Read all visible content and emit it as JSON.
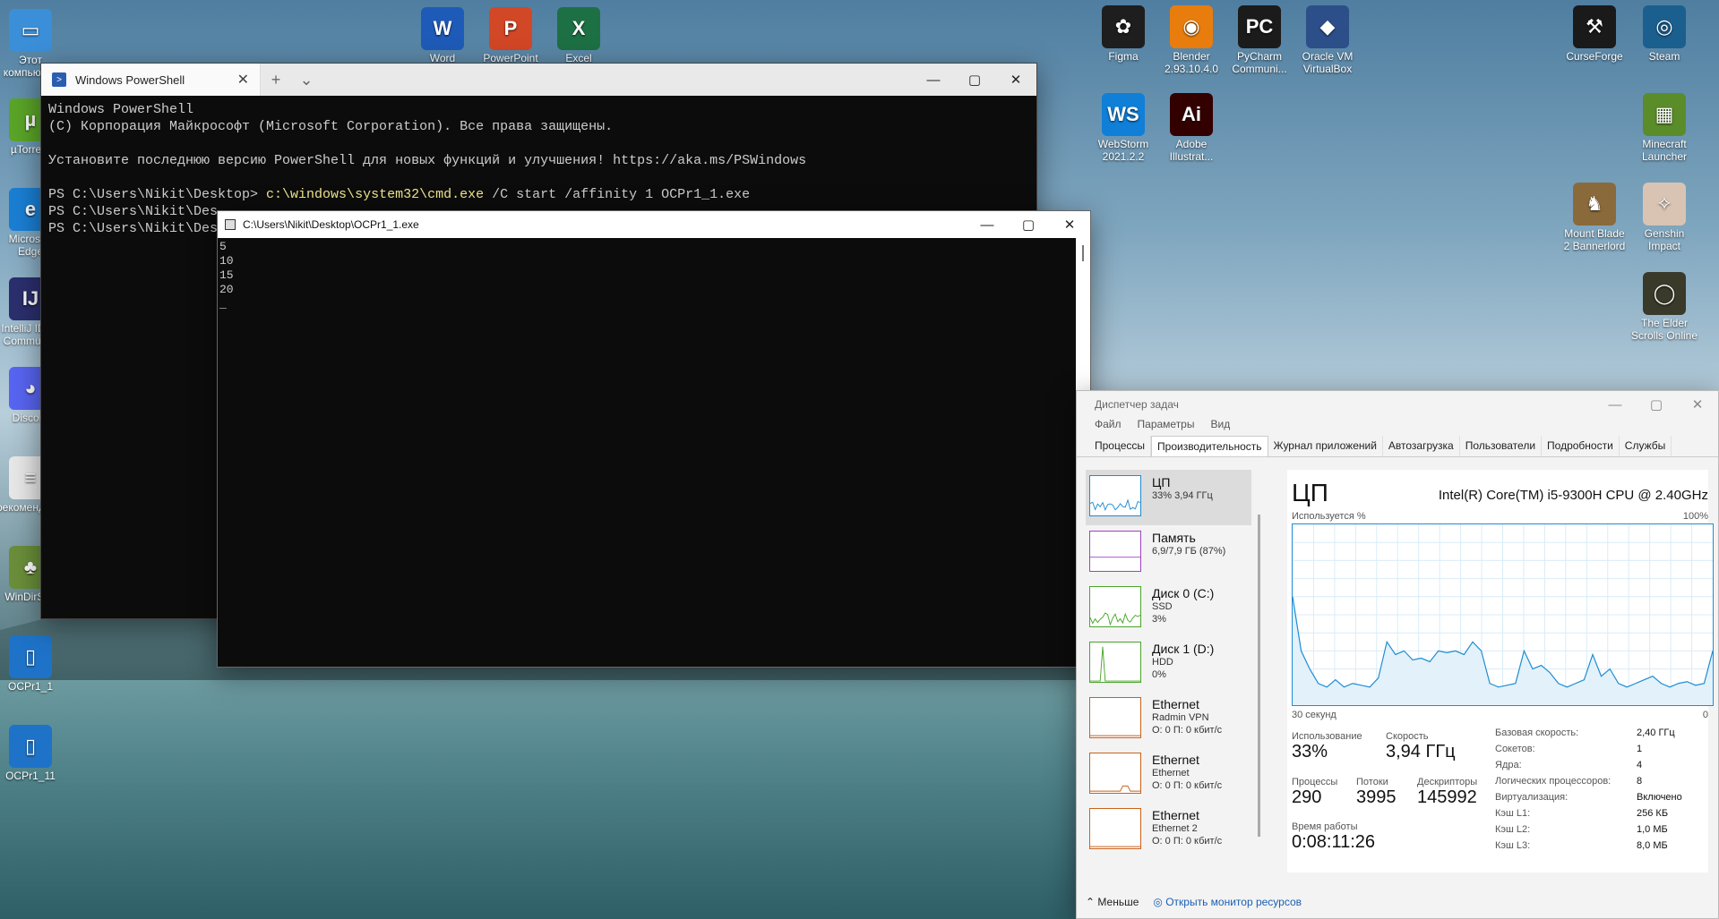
{
  "desktop": {
    "icons_left": [
      {
        "label": "Этот компьютер",
        "icon": "monitor-icon",
        "color": "#3a8fd8",
        "glyph": "▭"
      },
      {
        "label": "µTorrent",
        "icon": "utorrent-icon",
        "color": "#5aa528",
        "glyph": "µ"
      },
      {
        "label": "Microsoft Edge",
        "icon": "edge-icon",
        "color": "#1a7fd4",
        "glyph": "e"
      },
      {
        "label": "IntelliJ IDEA Community",
        "icon": "intellij-icon",
        "color": "#2b2f6e",
        "glyph": "IJ"
      },
      {
        "label": "Discord",
        "icon": "discord-icon",
        "color": "#5865f2",
        "glyph": "◕"
      },
      {
        "label": "рекомендации",
        "icon": "document-icon",
        "color": "#e8e8e8",
        "glyph": "≡"
      },
      {
        "label": "WinDirStat",
        "icon": "tree-icon",
        "color": "#6a8f3a",
        "glyph": "♣"
      },
      {
        "label": "OCPr1_1",
        "icon": "exe-icon",
        "color": "#1e73c8",
        "glyph": "▯"
      },
      {
        "label": "OCPr1_11",
        "icon": "exe-icon",
        "color": "#1e73c8",
        "glyph": "▯"
      }
    ],
    "icons_top": [
      {
        "label": "Word",
        "icon": "word-icon",
        "color": "#1e5bb8",
        "glyph": "W"
      },
      {
        "label": "PowerPoint",
        "icon": "powerpoint-icon",
        "color": "#d24726",
        "glyph": "P"
      },
      {
        "label": "Excel",
        "icon": "excel-icon",
        "color": "#1d7044",
        "glyph": "X"
      }
    ],
    "icons_right": [
      {
        "label": "Figma",
        "icon": "figma-icon",
        "color": "#1e1e1e",
        "glyph": "✿"
      },
      {
        "label": "Blender 2.93.10.4.0",
        "icon": "blender-icon",
        "color": "#e87d0d",
        "glyph": "◉"
      },
      {
        "label": "PyCharm Communi...",
        "icon": "pycharm-icon",
        "color": "#1b1b1b",
        "glyph": "PC"
      },
      {
        "label": "Oracle VM VirtualBox",
        "icon": "virtualbox-icon",
        "color": "#2c4f8a",
        "glyph": "◆"
      },
      {
        "label": "CurseForge",
        "icon": "curseforge-icon",
        "color": "#1a1a1a",
        "glyph": "⚒"
      },
      {
        "label": "Steam",
        "icon": "steam-icon",
        "color": "#1b5f8f",
        "glyph": "◎"
      },
      {
        "label": "WebStorm 2021.2.2",
        "icon": "webstorm-icon",
        "color": "#0f7fd8",
        "glyph": "WS"
      },
      {
        "label": "Adobe Illustrat...",
        "icon": "illustrator-icon",
        "color": "#330000",
        "glyph": "Ai"
      },
      {
        "label": "Minecraft Launcher",
        "icon": "minecraft-icon",
        "color": "#5a8c2a",
        "glyph": "▦"
      },
      {
        "label": "Mount Blade 2 Bannerlord",
        "icon": "bannerlord-icon",
        "color": "#8a6a3a",
        "glyph": "♞"
      },
      {
        "label": "Genshin Impact",
        "icon": "genshin-icon",
        "color": "#d9c4b4",
        "glyph": "✧"
      },
      {
        "label": "The Elder Scrolls Online",
        "icon": "eso-icon",
        "color": "#3a3a2a",
        "glyph": "◯"
      }
    ]
  },
  "powershell": {
    "tab_title": "Windows PowerShell",
    "lines": [
      "Windows PowerShell",
      "(C) Корпорация Майкрософт (Microsoft Corporation). Все права защищены.",
      "",
      "Установите последнюю версию PowerShell для новых функций и улучшения! https://aka.ms/PSWindows",
      ""
    ],
    "prompt1": "PS C:\\Users\\Nikit\\Desktop> ",
    "cmd1": "c:\\windows\\system32\\cmd.exe",
    "args1": " /C start /affinity 1 OCPr1_1.exe",
    "prompt2": "PS C:\\Users\\Nikit\\Des",
    "prompt3": "PS C:\\Users\\Nikit\\Des"
  },
  "cmd": {
    "title": "C:\\Users\\Nikit\\Desktop\\OCPr1_1.exe",
    "output": "5\n10\n15\n20\n_"
  },
  "taskmgr": {
    "title": "Диспетчер задач",
    "menu": [
      "Файл",
      "Параметры",
      "Вид"
    ],
    "tabs": [
      "Процессы",
      "Производительность",
      "Журнал приложений",
      "Автозагрузка",
      "Пользователи",
      "Подробности",
      "Службы"
    ],
    "resources": [
      {
        "name": "ЦП",
        "sub1": "33% 3,94 ГГц",
        "sub2": "",
        "kind": "cpu"
      },
      {
        "name": "Память",
        "sub1": "6,9/7,9 ГБ (87%)",
        "sub2": "",
        "kind": "mem"
      },
      {
        "name": "Диск 0 (C:)",
        "sub1": "SSD",
        "sub2": "3%",
        "kind": "disk"
      },
      {
        "name": "Диск 1 (D:)",
        "sub1": "HDD",
        "sub2": "0%",
        "kind": "disk"
      },
      {
        "name": "Ethernet",
        "sub1": "Radmin VPN",
        "sub2": "О: 0 П: 0 кбит/с",
        "kind": "eth"
      },
      {
        "name": "Ethernet",
        "sub1": "Ethernet",
        "sub2": "О: 0 П: 0 кбит/с",
        "kind": "eth"
      },
      {
        "name": "Ethernet",
        "sub1": "Ethernet 2",
        "sub2": "О: 0 П: 0 кбит/с",
        "kind": "eth"
      }
    ],
    "cpu": {
      "title": "ЦП",
      "cpu_name": "Intel(R) Core(TM) i5-9300H CPU @ 2.40GHz",
      "used_label": "Используется %",
      "max_label": "100%",
      "time_label": "30 секунд",
      "zero_label": "0",
      "usage_label": "Использование",
      "usage": "33%",
      "speed_label": "Скорость",
      "speed": "3,94 ГГц",
      "proc_label": "Процессы",
      "proc": "290",
      "threads_label": "Потоки",
      "threads": "3995",
      "handles_label": "Дескрипторы",
      "handles": "145992",
      "uptime_label": "Время работы",
      "uptime": "0:08:11:26",
      "specs": [
        {
          "k": "Базовая скорость:",
          "v": "2,40 ГГц"
        },
        {
          "k": "Сокетов:",
          "v": "1"
        },
        {
          "k": "Ядра:",
          "v": "4"
        },
        {
          "k": "Логических процессоров:",
          "v": "8"
        },
        {
          "k": "Виртуализация:",
          "v": "Включено"
        },
        {
          "k": "Кэш L1:",
          "v": "256 КБ"
        },
        {
          "k": "Кэш L2:",
          "v": "1,0 МБ"
        },
        {
          "k": "Кэш L3:",
          "v": "8,0 МБ"
        }
      ],
      "graph_usage": [
        60,
        30,
        20,
        12,
        10,
        14,
        10,
        12,
        11,
        10,
        15,
        35,
        28,
        30,
        25,
        26,
        24,
        30,
        29,
        30,
        28,
        35,
        30,
        12,
        10,
        11,
        12,
        30,
        20,
        22,
        18,
        12,
        10,
        12,
        14,
        28,
        16,
        20,
        12,
        10,
        12,
        14,
        16,
        12,
        10,
        12,
        13,
        11,
        12,
        30
      ]
    },
    "bottom_less": "Меньше",
    "bottom_link": "Открыть монитор ресурсов"
  }
}
